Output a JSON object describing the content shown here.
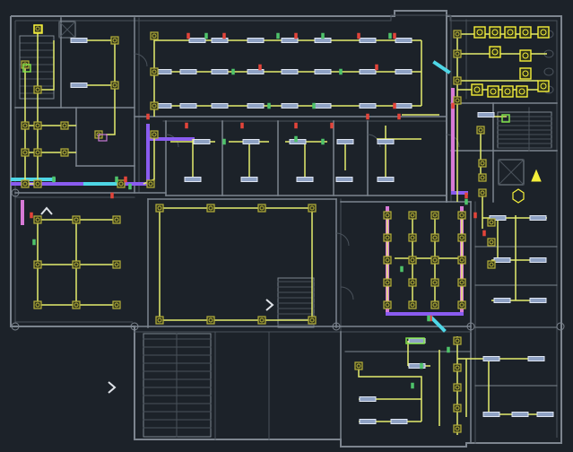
{
  "drawing": {
    "colors": {
      "background": "#1c2229",
      "wall": "#7d858f",
      "wall_dim": "#4a525b",
      "wiring": "#e4ec6e",
      "device_outline": "#b7b13a",
      "device_fill": "#2f331c",
      "fixture_fill": "#8fa2c4",
      "fixture_outline": "#dfe6f2",
      "duct_purple": "#8a5cf0",
      "duct_magenta": "#d77ad6",
      "duct_cyan": "#4ed6e6",
      "marker_red": "#e3443a",
      "marker_green": "#4ec36a",
      "panel_green": "#7fe04a",
      "bright_yellow": "#f4ef3a"
    },
    "symbols": {
      "fixture": "linear-light-fixture",
      "device": "junction-box",
      "panel": "electrical-panel",
      "stair": "staircase",
      "arrow": "stair-direction-chevron"
    }
  }
}
